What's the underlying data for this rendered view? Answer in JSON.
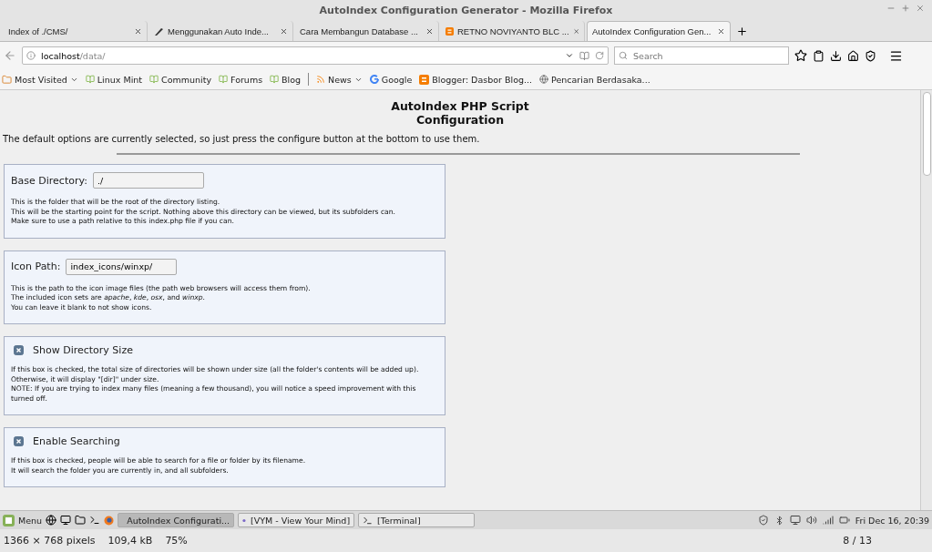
{
  "window": {
    "title": "AutoIndex Configuration Generator - Mozilla Firefox"
  },
  "tabs": [
    {
      "label": "Index of ./CMS/",
      "selected": false
    },
    {
      "label": "Menggunakan Auto Inde...",
      "selected": false,
      "kind": "pen"
    },
    {
      "label": "Cara Membangun Database ...",
      "selected": false
    },
    {
      "label": "RETNO NOVIYANTO BLC ...",
      "selected": false,
      "kind": "blogger"
    },
    {
      "label": "AutoIndex Configuration Gen...",
      "selected": true
    }
  ],
  "address": {
    "host": "localhost",
    "path": "/data/"
  },
  "search": {
    "placeholder": "Search"
  },
  "bookmarks": [
    {
      "label": "Most Visited",
      "kind": "folder",
      "menu": true
    },
    {
      "label": "Linux Mint",
      "kind": "page"
    },
    {
      "label": "Community",
      "kind": "page"
    },
    {
      "label": "Forums",
      "kind": "page"
    },
    {
      "label": "Blog",
      "kind": "page"
    },
    {
      "label": "News",
      "kind": "feed",
      "menu": true
    },
    {
      "label": "Google",
      "kind": "google"
    },
    {
      "label": "Blogger: Dasbor Blog...",
      "kind": "blogger"
    },
    {
      "label": "Pencarian Berdasaka...",
      "kind": "globe"
    }
  ],
  "page": {
    "heading": [
      "AutoIndex PHP Script",
      "Configuration"
    ],
    "intro": "The default options are currently selected, so just press the configure button at the bottom to use them.",
    "sections": [
      {
        "kind": "text",
        "label": "Base Directory:",
        "value": "./",
        "lines": [
          "This is the folder that will be the root of the directory listing.",
          "This will be the starting point for the script. Nothing above this directory can be viewed, but its subfolders can.",
          "Make sure to use a path relative to this index.php file if you can."
        ]
      },
      {
        "kind": "text",
        "label": "Icon Path:",
        "value": "index_icons/winxp/",
        "lines": [
          "This is the path to the icon image files (the path web browsers will access them from).",
          "The included icon sets are *apache*, *kde*, *osx*, and *winxp*.",
          "You can leave it blank to not show icons."
        ]
      },
      {
        "kind": "checkbox",
        "label": "Show Directory Size",
        "checked": true,
        "lines": [
          "If this box is checked, the total size of directories will be shown under size (all the folder's contents will be added up).",
          "Otherwise, it will display \"[dir]\" under size.",
          "NOTE: If you are trying to index many files (meaning a few thousand), you will notice a speed improvement with this turned off."
        ]
      },
      {
        "kind": "checkbox",
        "label": "Enable Searching",
        "checked": true,
        "lines": [
          "If this box is checked, people will be able to search for a file or folder by its filename.",
          "It will search the folder you are currently in, and all subfolders."
        ]
      }
    ]
  },
  "taskbar": {
    "menu": "Menu",
    "windows": [
      {
        "label": "AutoIndex Configurati...",
        "selected": true,
        "kind": "firefox"
      },
      {
        "label": "[VYM - View Your Mind]",
        "selected": false,
        "kind": "vym"
      },
      {
        "label": "[Terminal]",
        "selected": false,
        "kind": "terminal"
      }
    ],
    "clock": "Fri Dec 16, 20:39"
  },
  "viewer": {
    "dimensions": "1366 × 768 pixels",
    "size": "109,4 kB",
    "zoom": "75%",
    "counter": "8 / 13"
  }
}
